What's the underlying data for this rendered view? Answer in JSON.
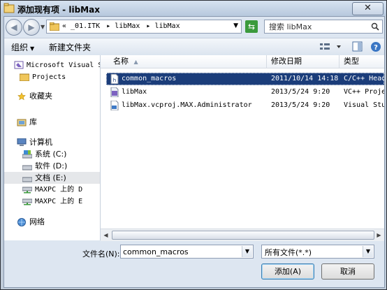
{
  "window": {
    "title": "添加现有项 - libMax",
    "close_label": "✕"
  },
  "address": {
    "crumbs": [
      {
        "label": "« _01.ITK"
      },
      {
        "label": "▸ libMax"
      },
      {
        "label": "▸ libMax"
      }
    ]
  },
  "search": {
    "value": "搜索 libMax"
  },
  "toolbar": {
    "organize_label": "组织",
    "new_folder_label": "新建文件夹"
  },
  "nav": {
    "items": [
      {
        "label": "Microsoft Visual Stu",
        "icon": "visual-studio-icon"
      },
      {
        "label": "Projects",
        "icon": "folder-icon"
      },
      {
        "label": "收藏夹",
        "icon": "star-icon"
      },
      {
        "label": "库",
        "icon": "library-icon"
      },
      {
        "label": "计算机",
        "icon": "computer-icon"
      },
      {
        "label": "系统 (C:)",
        "icon": "drive-c-icon"
      },
      {
        "label": "软件 (D:)",
        "icon": "drive-icon"
      },
      {
        "label": "文档 (E:)",
        "icon": "drive-icon"
      },
      {
        "label": "MAXPC 上的 D",
        "icon": "network-drive-icon"
      },
      {
        "label": "MAXPC 上的 E",
        "icon": "network-drive-icon"
      },
      {
        "label": "网络",
        "icon": "network-icon"
      }
    ],
    "selected_index": 7
  },
  "columns": {
    "name": "名称",
    "modified": "修改日期",
    "type": "类型"
  },
  "files": [
    {
      "name": "common_macros",
      "modified": "2011/10/14 14:18",
      "type": "C/C++ Header",
      "icon": "header-file-icon",
      "selected": true
    },
    {
      "name": "libMax",
      "modified": "2013/5/24 9:20",
      "type": "VC++ Project",
      "icon": "vcproj-icon",
      "selected": false
    },
    {
      "name": "libMax.vcproj.MAX.Administrator",
      "modified": "2013/5/24 9:20",
      "type": "Visual Studio",
      "icon": "user-file-icon",
      "selected": false
    }
  ],
  "footer": {
    "filename_label": "文件名(N):",
    "filename_value": "common_macros",
    "filetype_value": "所有文件(*.*)",
    "add_label": "添加(A)",
    "cancel_label": "取消"
  },
  "colors": {
    "selection": "#1b3d7a",
    "title_bar": "#c9d6e6",
    "window_bg": "#dde6f1"
  }
}
